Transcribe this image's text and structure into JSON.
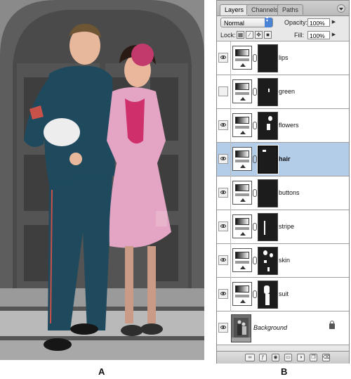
{
  "captions": {
    "a": "A",
    "b": "B"
  },
  "palette": {
    "tabs": [
      "Layers",
      "Channels",
      "Paths"
    ],
    "blend_mode": "Normal",
    "opacity_label": "Opacity:",
    "opacity_value": "100%",
    "lock_label": "Lock:",
    "fill_label": "Fill:",
    "fill_value": "100%",
    "selected_color": "#b3cde9",
    "layers": [
      {
        "name": "lips",
        "visible": true,
        "selected": false
      },
      {
        "name": "green",
        "visible": false,
        "selected": false
      },
      {
        "name": "flowers",
        "visible": true,
        "selected": false
      },
      {
        "name": "hair",
        "visible": true,
        "selected": true
      },
      {
        "name": "buttons",
        "visible": true,
        "selected": false
      },
      {
        "name": "stripe",
        "visible": true,
        "selected": false
      },
      {
        "name": "skin",
        "visible": true,
        "selected": false
      },
      {
        "name": "suit",
        "visible": true,
        "selected": false
      },
      {
        "name": "Background",
        "visible": true,
        "selected": false,
        "locked": true
      }
    ],
    "footer_icons": [
      "link-icon",
      "layer-style-icon",
      "add-mask-icon",
      "new-set-icon",
      "new-adjustment-layer-icon",
      "new-layer-icon",
      "trash-icon"
    ]
  }
}
